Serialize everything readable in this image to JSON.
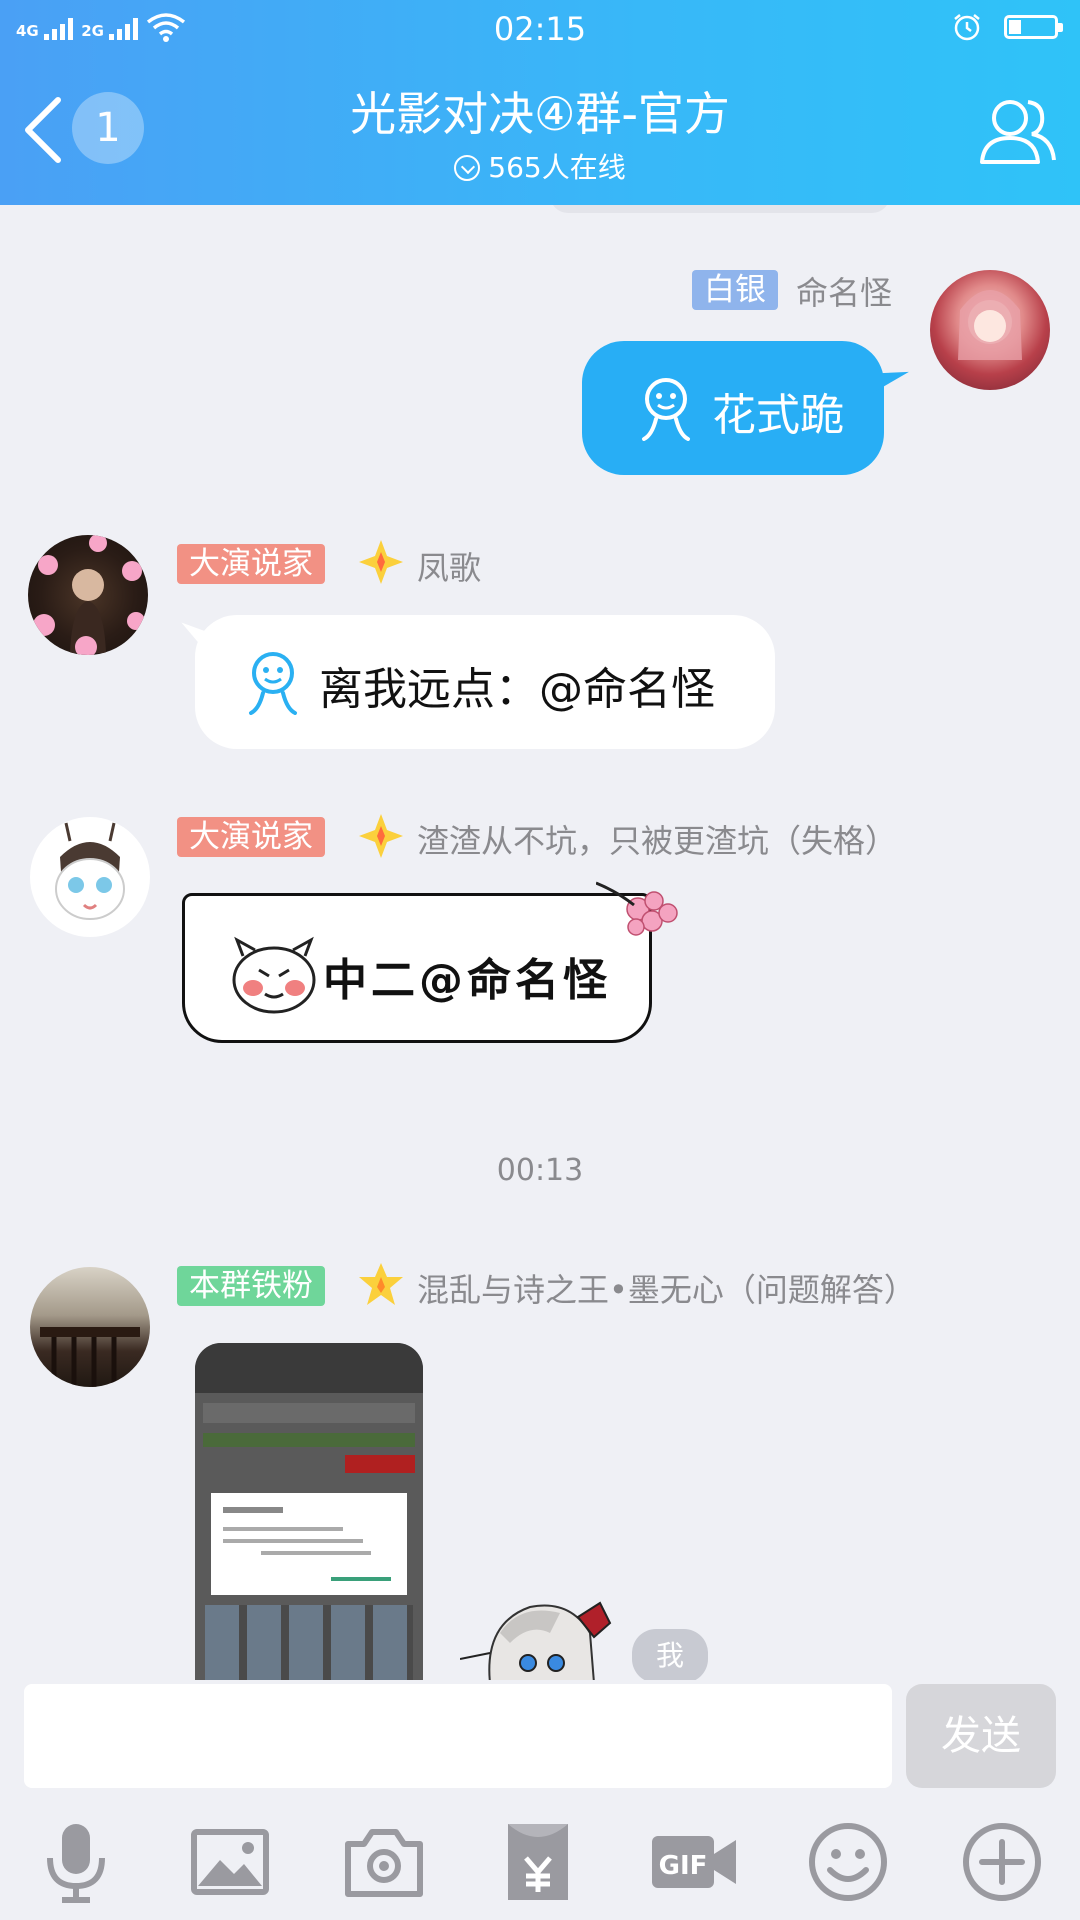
{
  "status_bar": {
    "network_left": "4G",
    "network_right": "2G",
    "time": "02:15"
  },
  "header": {
    "unread_count": "1",
    "title": "光影对决④群-官方",
    "online": "565人在线"
  },
  "messages": [
    {
      "badge": "白银",
      "badge_color": "#8fb4ec",
      "nick": "命名怪",
      "text": "花式跪"
    },
    {
      "badge": "大演说家",
      "badge_color": "#f29184",
      "nick": "凤歌",
      "text": "离我远点：@命名怪"
    },
    {
      "badge": "大演说家",
      "badge_color": "#f29184",
      "nick": "渣渣从不坑，只被更渣坑（失格）",
      "text": "中二@命名怪"
    },
    {
      "badge": "本群铁粉",
      "badge_color": "#6fd69a",
      "nick": "混乱与诗之王•墨无心（问题解答）",
      "sticker_text": "我"
    }
  ],
  "time_separator": "00:13",
  "input": {
    "placeholder": "",
    "send_label": "发送"
  },
  "toolbar": [
    "mic-icon",
    "image-icon",
    "camera-icon",
    "red-packet-icon",
    "gif-icon",
    "emoji-icon",
    "plus-icon"
  ],
  "colors": {
    "header": "#3aa8f7",
    "self_bubble": "#28aef5",
    "background": "#eff0f5"
  }
}
